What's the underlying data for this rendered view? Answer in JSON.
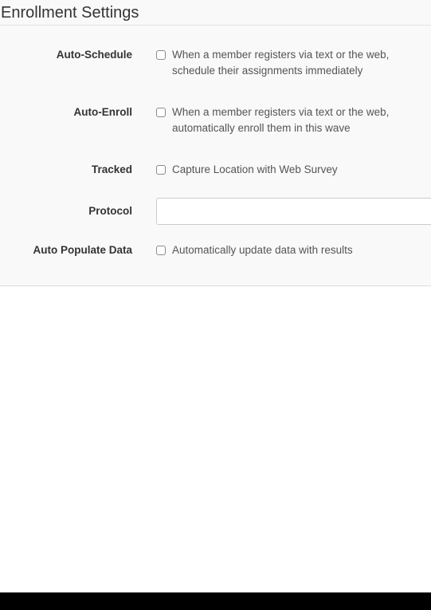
{
  "panel": {
    "title": "Enrollment Settings"
  },
  "settings": [
    {
      "label": "Auto-Schedule",
      "description": "When a member registers via text or the web, schedule their assignments immediately",
      "checked": false
    },
    {
      "label": "Auto-Enroll",
      "description": "When a member registers via text or the web, automatically enroll them in this wave",
      "checked": false
    },
    {
      "label": "Tracked",
      "description": "Capture Location with Web Survey",
      "checked": false
    },
    {
      "label": "Protocol",
      "value": "",
      "placeholder": ""
    },
    {
      "label": "Auto Populate Data",
      "description": "Automatically update data with results",
      "checked": false
    }
  ],
  "colors": {
    "panel_background": "#f9f9f9",
    "bottom_bar": "#000000"
  }
}
